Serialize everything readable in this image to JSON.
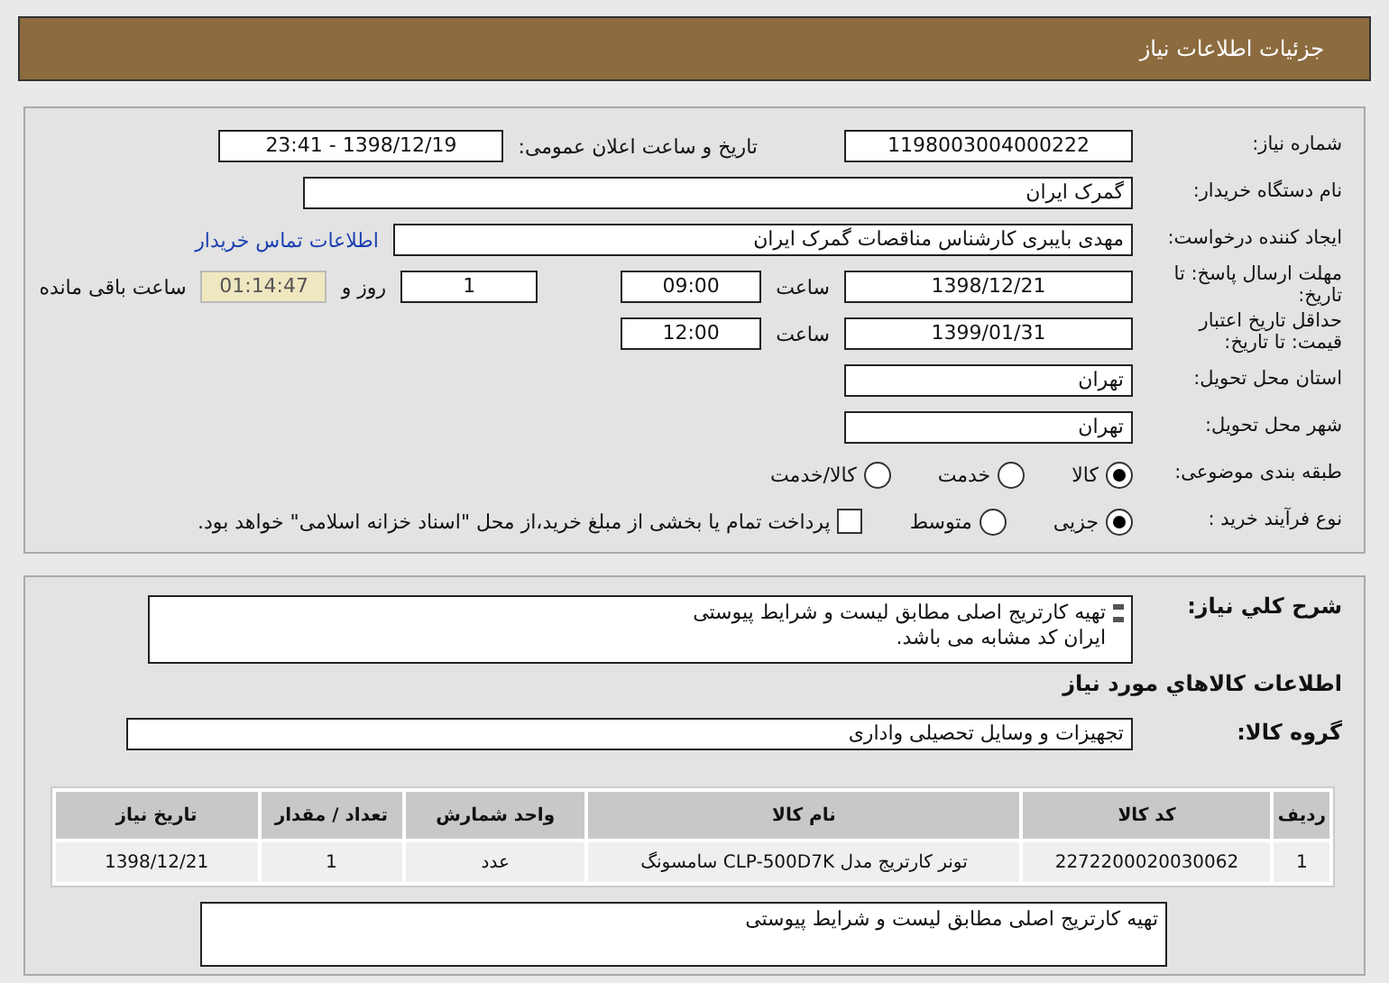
{
  "header": {
    "title": "جزئیات اطلاعات نیاز"
  },
  "need_number": {
    "label": "شماره نیاز:",
    "value": "1198003004000222"
  },
  "announce": {
    "label": "تاریخ و ساعت اعلان عمومی:",
    "value": "1398/12/19 - 23:41"
  },
  "buyer": {
    "label": "نام دستگاه خریدار:",
    "value": "گمرک ایران"
  },
  "creator": {
    "label": "ایجاد کننده درخواست:",
    "value": "مهدی بایبری کارشناس مناقصات گمرک ایران",
    "link": "اطلاعات تماس خریدار"
  },
  "deadline": {
    "label": "مهلت ارسال پاسخ: تا تاریخ:",
    "date": "1398/12/21",
    "time_label": "ساعت",
    "time": "09:00",
    "days": "1",
    "days_label": "روز و",
    "remaining": "01:14:47",
    "remaining_label": "ساعت باقی مانده"
  },
  "validity": {
    "label": "حداقل تاریخ اعتبار قیمت: تا تاریخ:",
    "date": "1399/01/31",
    "time_label": "ساعت",
    "time": "12:00"
  },
  "province": {
    "label": "استان محل تحویل:",
    "value": "تهران"
  },
  "city": {
    "label": "شهر محل تحویل:",
    "value": "تهران"
  },
  "category": {
    "label": "طبقه بندی موضوعی:",
    "options": [
      {
        "label": "کالا",
        "selected": true
      },
      {
        "label": "خدمت",
        "selected": false
      },
      {
        "label": "کالا/خدمت",
        "selected": false
      }
    ]
  },
  "process": {
    "label": "نوع فرآیند خرید :",
    "options": [
      {
        "label": "جزیی",
        "selected": true
      },
      {
        "label": "متوسط",
        "selected": false
      }
    ],
    "payment": {
      "checked": false,
      "text": "پرداخت تمام یا بخشی از مبلغ خرید،از محل \"اسناد خزانه اسلامی\" خواهد بود."
    }
  },
  "description": {
    "label": "شرح کلي نياز:",
    "lines": [
      "تهیه کارتریج اصلی مطابق لیست و شرایط پیوستی",
      "ایران کد مشابه می باشد."
    ]
  },
  "goods_heading": "اطلاعات کالاهاي مورد نياز",
  "goods_group": {
    "label": "گروه کالا:",
    "value": "تجهیزات و وسایل تحصیلی واداری"
  },
  "table": {
    "columns": [
      "ردیف",
      "کد کالا",
      "نام کالا",
      "واحد شمارش",
      "تعداد / مقدار",
      "تاریخ نیاز"
    ],
    "rows": [
      [
        "1",
        "2272200020030062",
        "تونر کارتریج مدل CLP-500D7K سامسونگ",
        "عدد",
        "1",
        "1398/12/21"
      ]
    ]
  },
  "note": {
    "lines": [
      "تهیه کارتریج اصلی مطابق لیست و شرایط پیوستی"
    ]
  }
}
